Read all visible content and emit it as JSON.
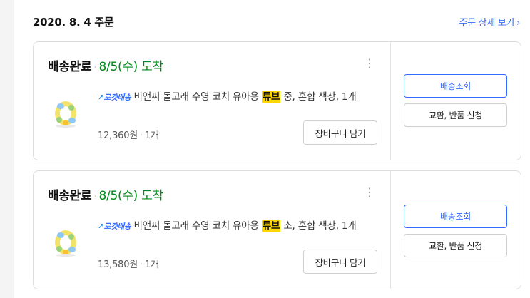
{
  "order": {
    "date": "2020. 8. 4 주문",
    "detail_link": "주문 상세 보기"
  },
  "items": [
    {
      "status": "배송완료",
      "arrival": "8/5(수) 도착",
      "rocket_label": "로켓배송",
      "name_before": "비앤씨 돌고래 수영 코치 유아용 ",
      "name_highlight": "튜브",
      "name_after": " 중, 혼합 색상, 1개",
      "price": "12,360원",
      "qty": "1개",
      "cart_button": "장바구니 담기",
      "track_button": "배송조회",
      "return_button": "교환, 반품 신청"
    },
    {
      "status": "배송완료",
      "arrival": "8/5(수) 도착",
      "rocket_label": "로켓배송",
      "name_before": "비앤씨 돌고래 수영 코치 유아용 ",
      "name_highlight": "튜브",
      "name_after": " 소, 혼합 색상, 1개",
      "price": "13,580원",
      "qty": "1개",
      "cart_button": "장바구니 담기",
      "track_button": "배송조회",
      "return_button": "교환, 반품 신청"
    }
  ],
  "icons": {
    "kebab": "more-vertical-icon",
    "chevron": "chevron-right-icon",
    "rocket": "rocket-icon"
  },
  "colors": {
    "accent": "#346aff",
    "arrival_green": "#00891a",
    "highlight": "#ffd600"
  }
}
